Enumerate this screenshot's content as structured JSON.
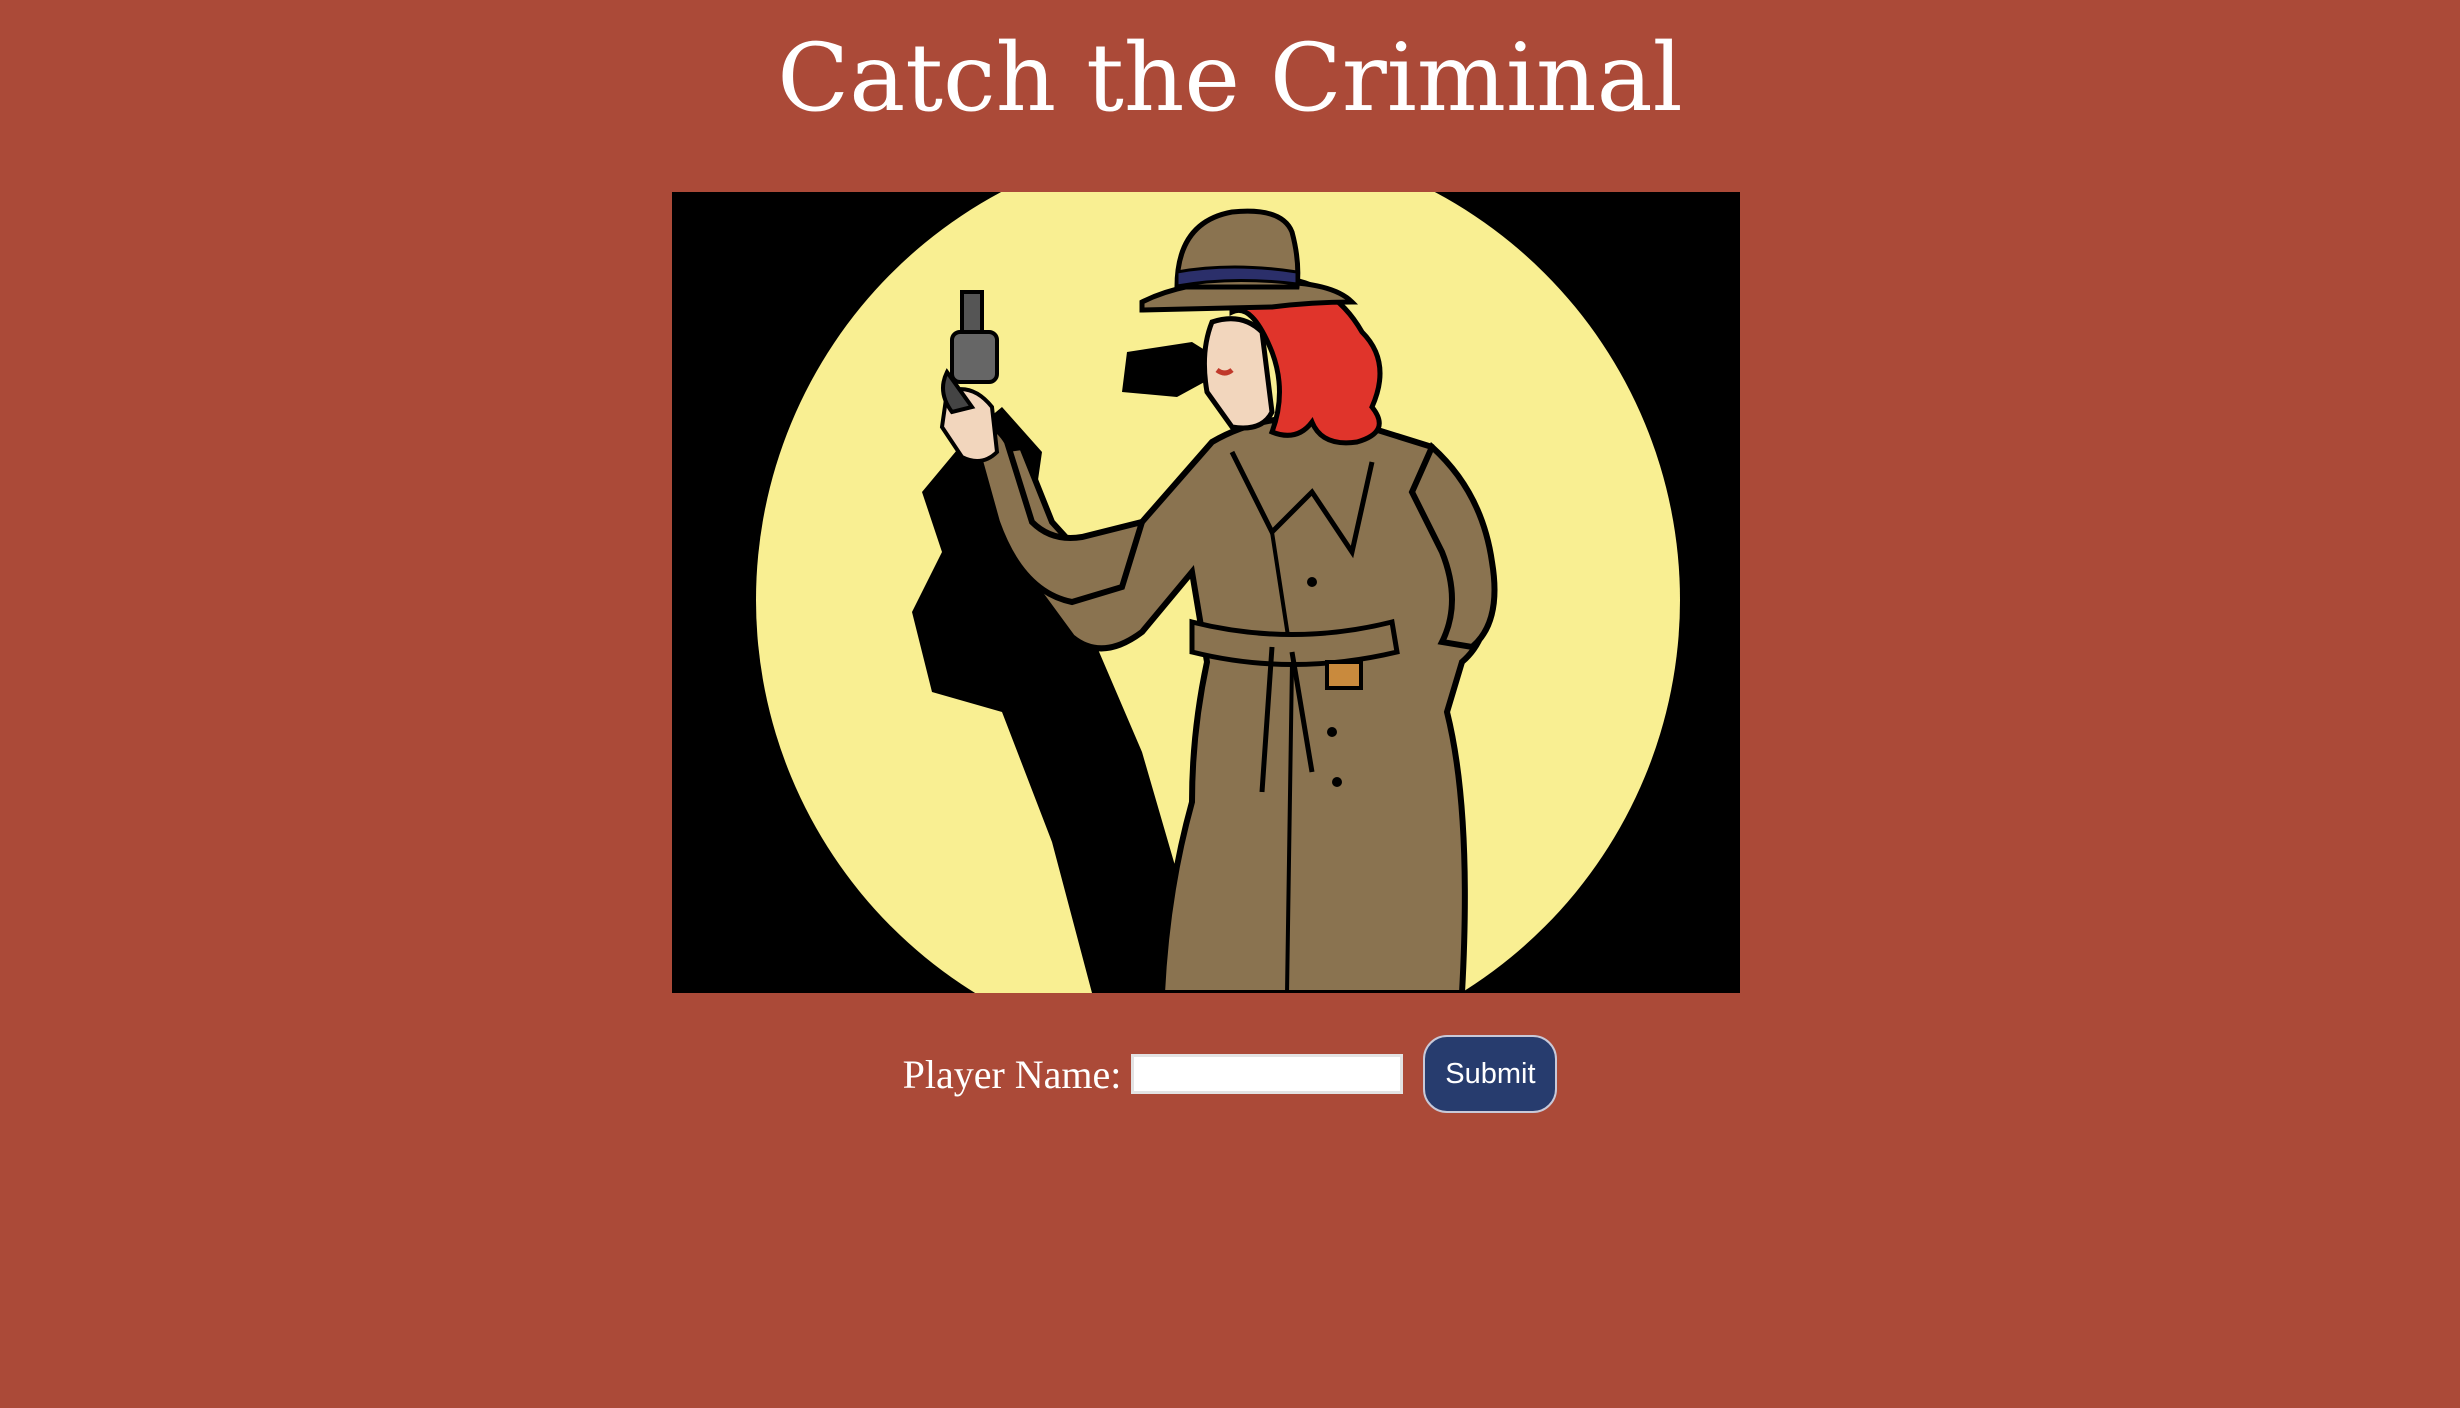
{
  "page": {
    "title": "Catch the Criminal",
    "background_color": "#ab4a38"
  },
  "hero_image": {
    "description_icon": "detective-woman-illustration",
    "colors": {
      "spotlight": "#f9ef92",
      "backdrop": "#000000",
      "coat": "#8a7350",
      "hair": "#e0342b"
    }
  },
  "form": {
    "label": "Player Name:",
    "input_value": "",
    "input_placeholder": "",
    "submit_label": "Submit",
    "submit_color": "#273c6e"
  }
}
